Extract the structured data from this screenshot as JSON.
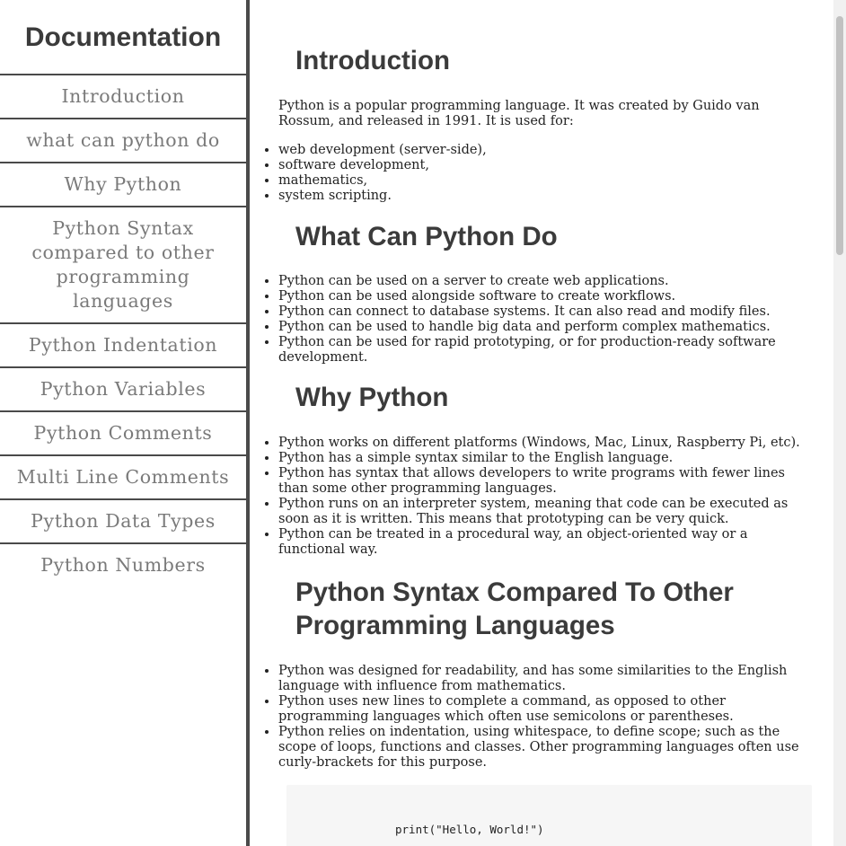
{
  "navbar": {
    "title": "Documentation",
    "items": [
      {
        "label": "Introduction"
      },
      {
        "label": "what can python do"
      },
      {
        "label": "Why Python"
      },
      {
        "label": "Python Syntax compared to other programming languages"
      },
      {
        "label": "Python Indentation"
      },
      {
        "label": "Python Variables"
      },
      {
        "label": "Python Comments"
      },
      {
        "label": "Multi Line Comments"
      },
      {
        "label": "Python Data Types"
      },
      {
        "label": "Python Numbers"
      }
    ]
  },
  "sections": {
    "introduction": {
      "title": "Introduction",
      "paragraph": "Python is a popular programming language. It was created by Guido van Rossum, and released in 1991. It is used for:",
      "items": [
        "web development (server-side),",
        "software development,",
        "mathematics,",
        "system scripting."
      ]
    },
    "what_can_python_do": {
      "title": "What Can Python Do",
      "items": [
        "Python can be used on a server to create web applications.",
        "Python can be used alongside software to create workflows.",
        "Python can connect to database systems. It can also read and modify files.",
        "Python can be used to handle big data and perform complex mathematics.",
        "Python can be used for rapid prototyping, or for production-ready software development."
      ]
    },
    "why_python": {
      "title": "Why Python",
      "items": [
        "Python works on different platforms (Windows, Mac, Linux, Raspberry Pi, etc).",
        "Python has a simple syntax similar to the English language.",
        "Python has syntax that allows developers to write programs with fewer lines than some other programming languages.",
        "Python runs on an interpreter system, meaning that code can be executed as soon as it is written. This means that prototyping can be very quick.",
        "Python can be treated in a procedural way, an object-oriented way or a functional way."
      ]
    },
    "syntax_compared": {
      "title": "Python Syntax Compared To Other Programming Languages",
      "items": [
        "Python was designed for readability, and has some similarities to the English language with influence from mathematics.",
        "Python uses new lines to complete a command, as opposed to other programming languages which often use semicolons or parentheses.",
        "Python relies on indentation, using whitespace, to define scope; such as the scope of loops, functions and classes. Other programming languages often use curly-brackets for this purpose."
      ],
      "code": "print(\"Hello, World!\")"
    }
  }
}
